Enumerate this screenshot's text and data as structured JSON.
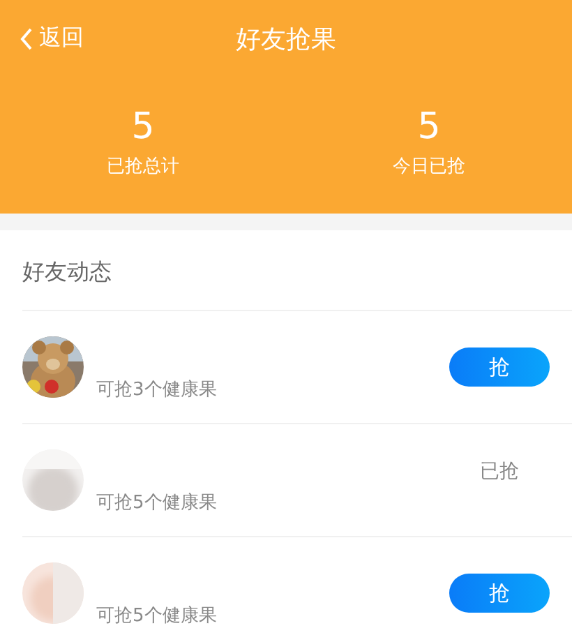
{
  "nav": {
    "back": "返回",
    "title": "好友抢果"
  },
  "stats": [
    {
      "value": "5",
      "label": "已抢总计"
    },
    {
      "value": "5",
      "label": "今日已抢"
    }
  ],
  "section": {
    "title": "好友动态"
  },
  "friends": [
    {
      "info": "可抢3个健康果",
      "grabbed": false,
      "action": "抢"
    },
    {
      "kind": "blurred",
      "info": "可抢5个健康果",
      "grabbed": true,
      "action": "已抢"
    },
    {
      "kind": "blurred_warm",
      "info": "可抢5个健康果",
      "grabbed": false,
      "action": "抢"
    }
  ]
}
